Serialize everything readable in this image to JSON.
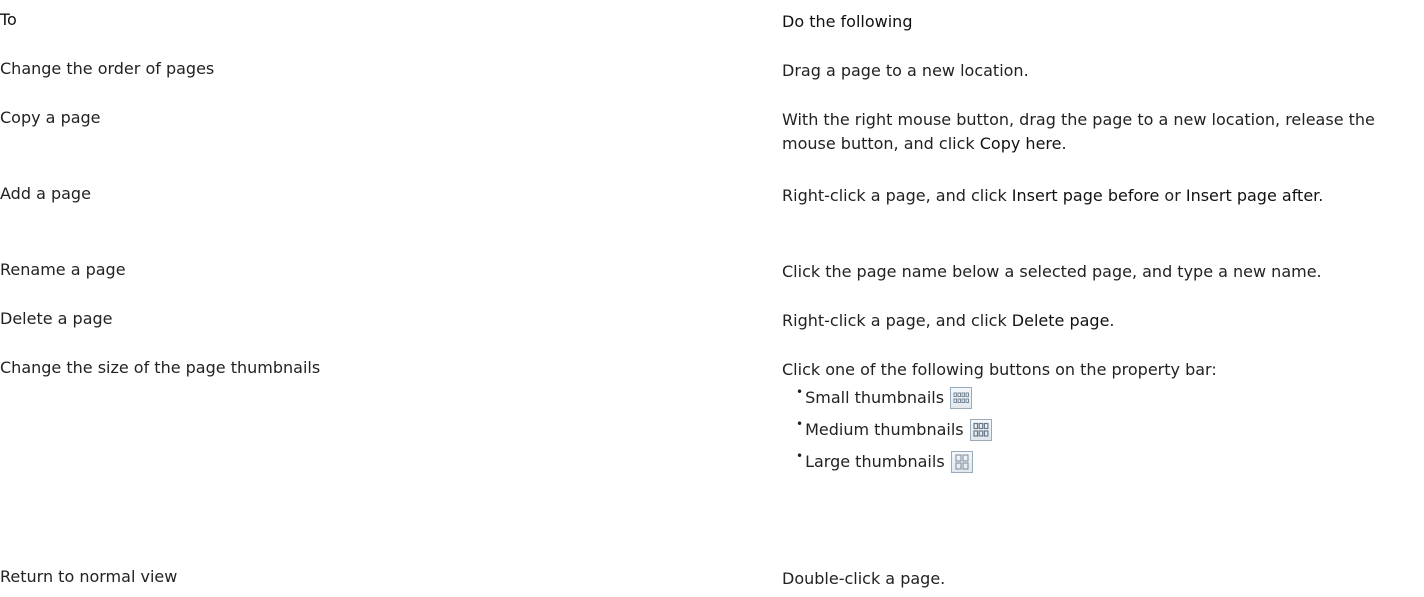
{
  "header": {
    "to": "To",
    "do": "Do the following"
  },
  "rows": [
    {
      "to": "Change the order of pages",
      "do": "Drag a page to a new location."
    },
    {
      "to": "Copy a page",
      "do_pre": "With the right mouse button, drag the page to a new location, release the mouse button, and click ",
      "do_b1": "Copy here",
      "do_post": "."
    },
    {
      "to": "Add a page",
      "do_pre": "Right-click a page, and click ",
      "do_b1": "Insert page before",
      "do_mid": " or ",
      "do_b2": "Insert page after",
      "do_post": "."
    },
    {
      "to": "Rename a page",
      "do": "Click the page name below a selected page, and type a new name."
    },
    {
      "to": "Delete a page",
      "do_pre": "Right-click a page, and click ",
      "do_b1": "Delete page",
      "do_post": "."
    },
    {
      "to": "Change the size of the page thumbnails",
      "do": "Click one of the following buttons on the property bar:"
    },
    {
      "to": "Return to normal view",
      "do": "Double-click a page."
    }
  ],
  "buttons": [
    {
      "label": "Small thumbnails",
      "icon": "small-thumbnails-icon"
    },
    {
      "label": "Medium thumbnails",
      "icon": "medium-thumbnails-icon"
    },
    {
      "label": "Large thumbnails",
      "icon": "large-thumbnails-icon"
    }
  ],
  "bullet": "•"
}
